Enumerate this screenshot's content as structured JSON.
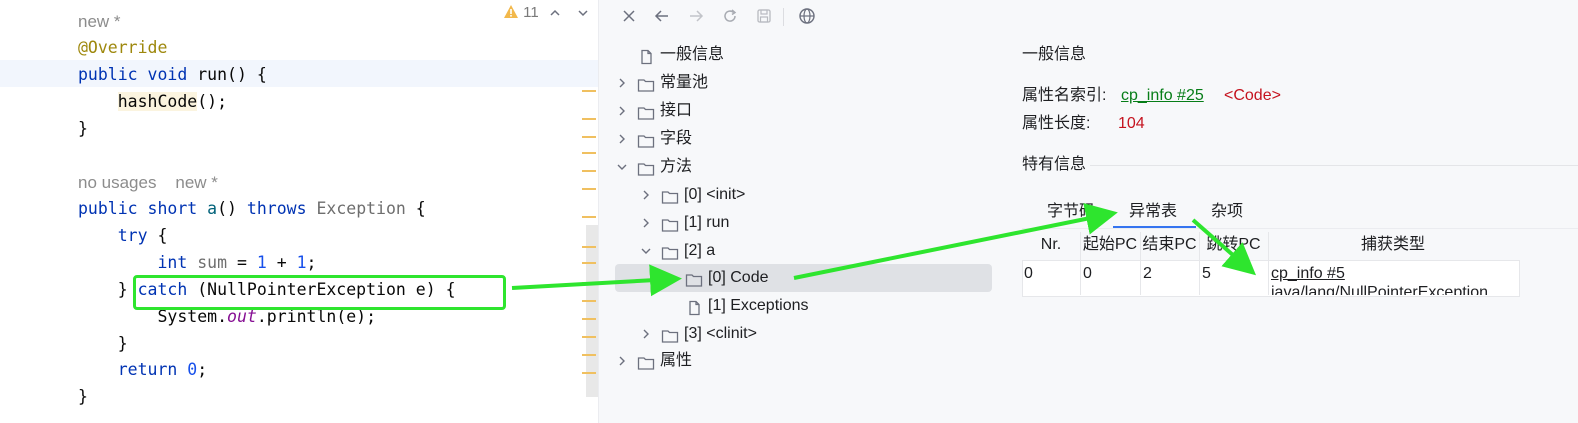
{
  "editor": {
    "top_hint": "new *",
    "line_annotation": "@Override",
    "run_line": {
      "kw_public": "public",
      "kw_void": "void",
      "name": "run",
      "rest": "() {"
    },
    "hashcode_call": "hashCode",
    "hashcode_rest": "();",
    "brace_close_1": "}",
    "usage_hint": "no usages",
    "usage_new": "new *",
    "a_line": {
      "kw_public": "public",
      "kw_short": "short",
      "name": "a",
      "parens": "()",
      "kw_throws": "throws",
      "type": "Exception",
      "brace": "{"
    },
    "try_kw": "try",
    "try_brace": "{",
    "int_line": {
      "kw": "int",
      "var": "sum",
      "eq": "=",
      "n1": "1",
      "plus": "+",
      "n2": "1",
      "semi": ";"
    },
    "catch_line": {
      "brace": "}",
      "kw": "catch",
      "rest": "(NullPointerException e) {"
    },
    "println_line": {
      "obj": "System.",
      "field": "out",
      "rest": ".println(e);"
    },
    "brace_close_2": "}",
    "return_line": {
      "kw": "return",
      "num": "0",
      "semi": ";"
    },
    "brace_close_3": "}",
    "warnings_count": "11"
  },
  "tree": {
    "items": [
      {
        "label": "一般信息",
        "icon": "file-icon"
      },
      {
        "label": "常量池",
        "icon": "folder-icon"
      },
      {
        "label": "接口",
        "icon": "folder-icon"
      },
      {
        "label": "字段",
        "icon": "folder-icon"
      },
      {
        "label": "方法",
        "icon": "folder-icon"
      },
      {
        "label": "[0] <init>",
        "icon": "folder-icon"
      },
      {
        "label": "[1] run",
        "icon": "folder-icon"
      },
      {
        "label": "[2] a",
        "icon": "folder-icon"
      },
      {
        "label": "[0] Code",
        "icon": "folder-icon"
      },
      {
        "label": "[1] Exceptions",
        "icon": "file-icon"
      },
      {
        "label": "[3] <clinit>",
        "icon": "folder-icon"
      },
      {
        "label": "属性",
        "icon": "folder-icon"
      }
    ]
  },
  "details": {
    "general_title": "一般信息",
    "attr_name_index_label": "属性名索引:",
    "attr_name_index_link": "cp_info #25",
    "attr_name_index_value": "<Code>",
    "attr_length_label": "属性长度:",
    "attr_length_value": "104",
    "specific_title": "特有信息",
    "tabs": [
      "字节码",
      "异常表",
      "杂项"
    ],
    "table": {
      "headers": [
        "Nr.",
        "起始PC",
        "结束PC",
        "跳转PC",
        "捕获类型"
      ],
      "row": {
        "nr": "0",
        "start_pc": "0",
        "end_pc": "2",
        "handler_pc": "5",
        "catch_link": "cp_info #5",
        "catch_type": "java/lang/NullPointerException"
      }
    }
  },
  "colors": {
    "highlight_box": "#2ee52e",
    "tab_underline": "#3574f0",
    "link": "#067d17",
    "value_red": "#c5131f"
  }
}
